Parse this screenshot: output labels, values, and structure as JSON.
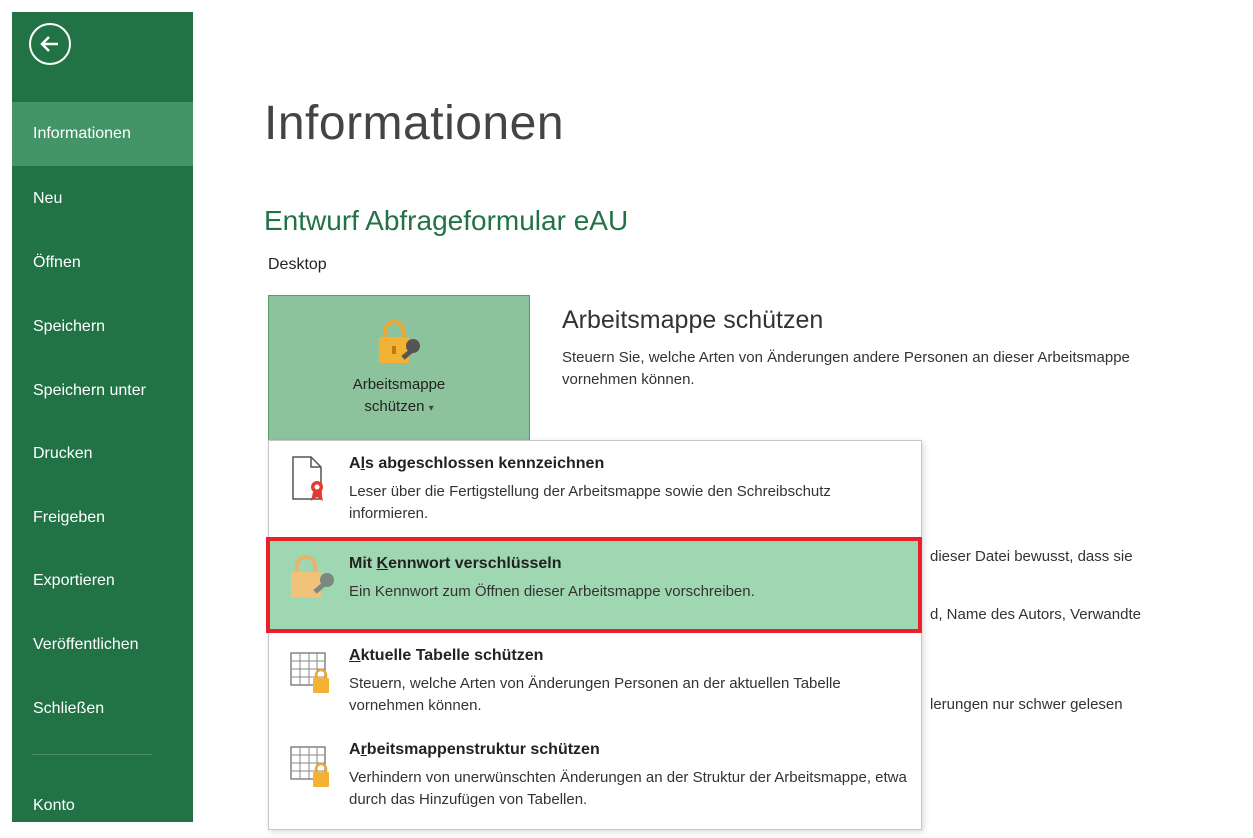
{
  "sidebar": {
    "items": [
      {
        "label": "Informationen",
        "active": true
      },
      {
        "label": "Neu"
      },
      {
        "label": "Öffnen"
      },
      {
        "label": "Speichern"
      },
      {
        "label": "Speichern unter"
      },
      {
        "label": "Drucken"
      },
      {
        "label": "Freigeben"
      },
      {
        "label": "Exportieren"
      },
      {
        "label": "Veröffentlichen"
      },
      {
        "label": "Schließen"
      }
    ],
    "account": "Konto",
    "back_icon": "back-arrow-icon"
  },
  "main": {
    "page_title": "Informationen",
    "doc_title": "Entwurf Abfrageformular eAU",
    "doc_location": "Desktop",
    "protect": {
      "button_line1": "Arbeitsmappe",
      "button_line2": "schützen",
      "button_caret": "▾",
      "heading": "Arbeitsmappe schützen",
      "description": "Steuern Sie, welche Arten von Änderungen andere Personen an dieser Arbeitsmappe vornehmen können."
    },
    "background_fragments": {
      "line1": "dieser Datei bewusst, dass sie",
      "line2": "d, Name des Autors, Verwandte",
      "line3": "lerungen nur schwer gelesen"
    }
  },
  "dropdown": {
    "items": [
      {
        "title_pre": "A",
        "title_key": "l",
        "title_post": "s abgeschlossen kennzeichnen",
        "description": "Leser über die Fertigstellung der Arbeitsmappe sowie den Schreibschutz informieren."
      },
      {
        "title_pre": "Mit ",
        "title_key": "K",
        "title_post": "ennwort verschlüsseln",
        "description": "Ein Kennwort zum Öffnen dieser Arbeitsmappe vorschreiben."
      },
      {
        "title_pre": "",
        "title_key": "A",
        "title_post": "ktuelle Tabelle schützen",
        "description": "Steuern, welche Arten von Änderungen Personen an der aktuellen Tabelle vornehmen können."
      },
      {
        "title_pre": "A",
        "title_key": "r",
        "title_post": "beitsmappenstruktur schützen",
        "description": "Verhindern von unerwünschten Änderungen an der Struktur der Arbeitsmappe, etwa durch das Hinzufügen von Tabellen."
      }
    ]
  },
  "colors": {
    "sidebar": "#217346",
    "sidebar_active": "#439467",
    "highlight": "#a0d7b3",
    "frame": "#e8202a"
  }
}
